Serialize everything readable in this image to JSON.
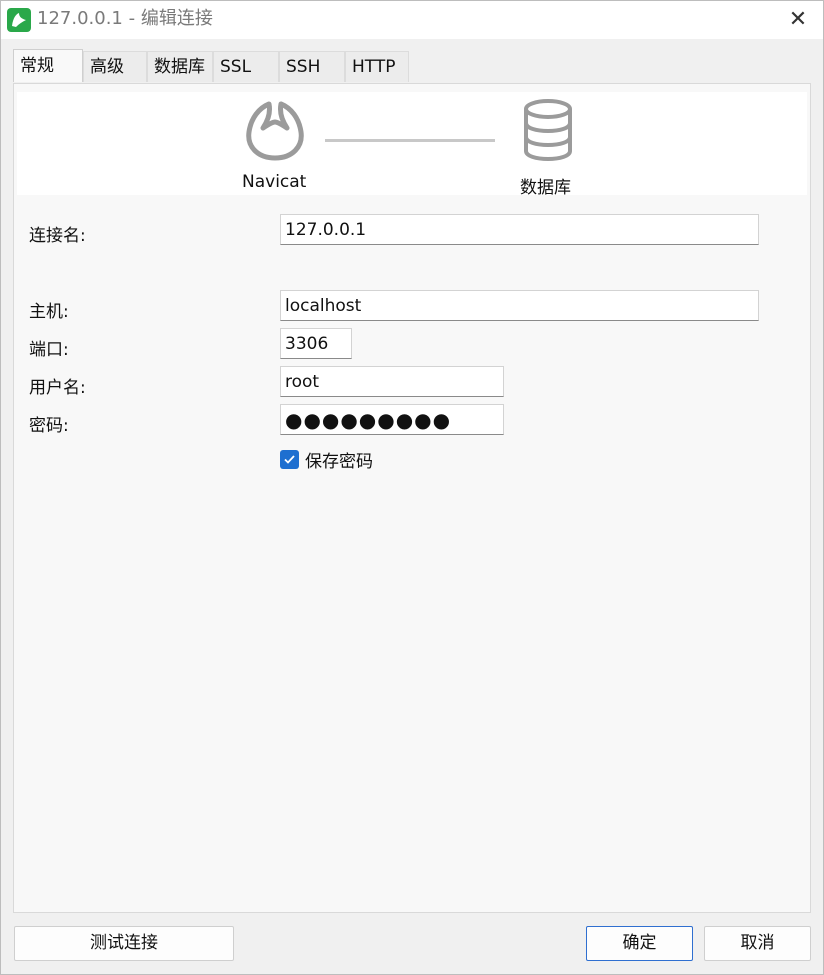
{
  "window": {
    "title": "127.0.0.1 - 编辑连接",
    "close_symbol": "✕"
  },
  "tabs": [
    {
      "label": "常规",
      "active": true
    },
    {
      "label": "高级",
      "active": false
    },
    {
      "label": "数据库",
      "active": false
    },
    {
      "label": "SSL",
      "active": false
    },
    {
      "label": "SSH",
      "active": false
    },
    {
      "label": "HTTP",
      "active": false
    }
  ],
  "diagram": {
    "left_label": "Navicat",
    "right_label": "数据库",
    "left_icon": "navicat-logo-icon",
    "right_icon": "database-icon"
  },
  "form": {
    "connection_name": {
      "label": "连接名:",
      "value": "127.0.0.1"
    },
    "host": {
      "label": "主机:",
      "value": "localhost"
    },
    "port": {
      "label": "端口:",
      "value": "3306"
    },
    "username": {
      "label": "用户名:",
      "value": "root"
    },
    "password": {
      "label": "密码:",
      "value": "●●●●●●●●●"
    },
    "save_password": {
      "label": "保存密码",
      "checked": true
    }
  },
  "buttons": {
    "test_connection": "测试连接",
    "ok": "确定",
    "cancel": "取消"
  },
  "colors": {
    "accent": "#1e6fd0",
    "app_icon": "#2aa84a"
  }
}
